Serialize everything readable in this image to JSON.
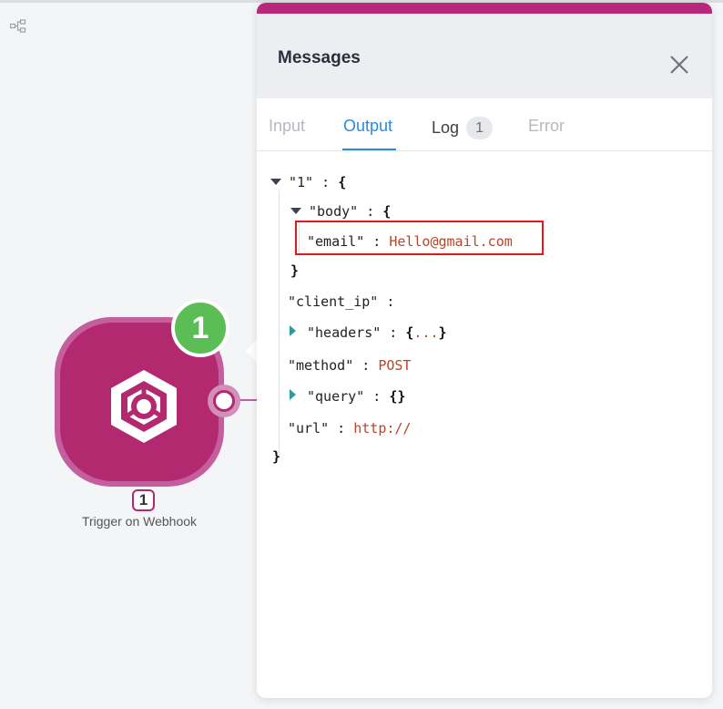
{
  "canvas": {
    "background_color": "#f4f5f7",
    "tree_icon": "tree-structure-icon"
  },
  "node": {
    "label": "Trigger on Webhook",
    "id_badge": "1",
    "execution_count": "1",
    "logo_icon": "webhook-hexagon-icon",
    "color": "#b3296f",
    "badge_color": "#5bbd55"
  },
  "panel": {
    "title": "Messages",
    "close_icon": "close-icon",
    "accent_color": "#b8287a",
    "tabs": [
      {
        "label": "Input",
        "active": false
      },
      {
        "label": "Output",
        "active": true
      },
      {
        "label": "Log",
        "active": false,
        "count": "1"
      },
      {
        "label": "Error",
        "active": false
      }
    ],
    "active_tab_color": "#2a8bdc"
  },
  "output": {
    "root_key": "\"1\"",
    "body_key": "\"body\"",
    "email_key": "\"email\"",
    "email_value": "Hello@gmail.com",
    "client_ip_key": "\"client_ip\"",
    "headers_key": "\"headers\"",
    "headers_collapsed": "...",
    "method_key": "\"method\"",
    "method_value": "POST",
    "query_key": "\"query\"",
    "query_value": "{}",
    "url_key": "\"url\"",
    "url_value": "http://",
    "value_color": "#b8452a",
    "highlight_color": "#e11b1b"
  }
}
